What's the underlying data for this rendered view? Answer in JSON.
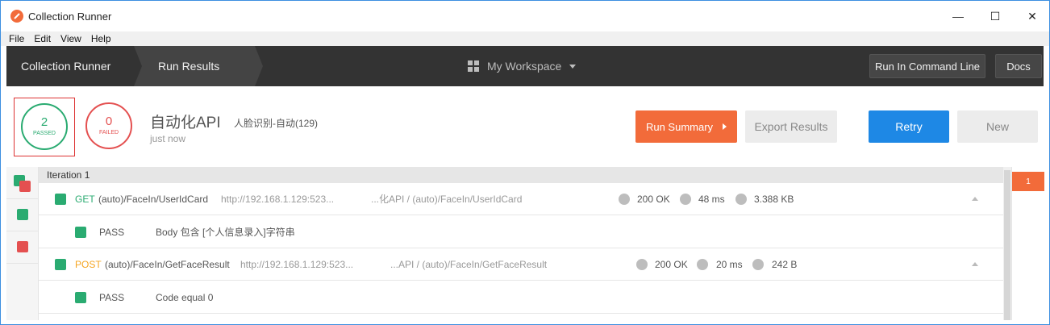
{
  "window": {
    "title": "Collection Runner",
    "controls": {
      "minimize": "—",
      "maximize": "☐",
      "close": "✕"
    }
  },
  "menu": [
    "File",
    "Edit",
    "View",
    "Help"
  ],
  "header": {
    "crumbs": [
      "Collection Runner",
      "Run Results"
    ],
    "workspace": "My Workspace",
    "run_cmd_label": "Run In Command Line",
    "docs_label": "Docs"
  },
  "summary": {
    "passed_count": "2",
    "passed_label": "PASSED",
    "failed_count": "0",
    "failed_label": "FAILED",
    "run_name": "自动化API",
    "collection": "人脸识别-自动(129)",
    "time": "just now",
    "run_summary_label": "Run Summary",
    "export_label": "Export Results",
    "retry_label": "Retry",
    "new_label": "New"
  },
  "results": {
    "iteration_label": "Iteration 1",
    "requests": [
      {
        "method": "GET",
        "name": "(auto)/FaceIn/UserIdCard",
        "url": "http://192.168.1.129:523...",
        "path": "...化API / (auto)/FaceIn/UserIdCard",
        "status": "200 OK",
        "time": "48 ms",
        "size": "3.388 KB",
        "test": {
          "result": "PASS",
          "name": "Body 包含 [个人信息录入]字符串"
        }
      },
      {
        "method": "POST",
        "name": "(auto)/FaceIn/GetFaceResult",
        "url": "http://192.168.1.129:523...",
        "path": "...API / (auto)/FaceIn/GetFaceResult",
        "status": "200 OK",
        "time": "20 ms",
        "size": "242 B",
        "test": {
          "result": "PASS",
          "name": "Code equal 0"
        }
      }
    ]
  },
  "iteration_badge": "1",
  "colors": {
    "pass": "#2aab71",
    "fail": "#e45050",
    "accent": "#f26b3a",
    "primary": "#1e88e5",
    "header_bg": "#333333"
  }
}
